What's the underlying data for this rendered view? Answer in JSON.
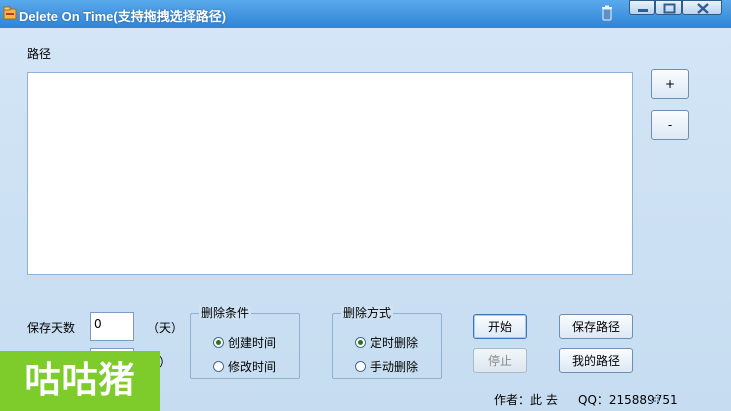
{
  "window": {
    "title": "Delete On Time(支持拖拽选择路径)"
  },
  "path_section": {
    "label": "路径",
    "add_label": "+",
    "remove_label": "-"
  },
  "settings": {
    "days_label": "保存天数",
    "days_value": "0",
    "days_unit": "（天）",
    "second_unit_partial": "点）"
  },
  "delete_condition": {
    "title": "删除条件",
    "options": [
      "创建时间",
      "修改时间"
    ],
    "selected": "创建时间"
  },
  "delete_mode": {
    "title": "删除方式",
    "options": [
      "定时删除",
      "手动删除"
    ],
    "selected": "定时删除"
  },
  "buttons": {
    "start": "开始",
    "stop": "停止",
    "save_path": "保存路径",
    "my_path": "我的路径"
  },
  "status": {
    "author": "作者：此  去",
    "qq": "QQ：215889751"
  },
  "watermark": "咕咕猪",
  "colors": {
    "titlebar": "#3a8fdd",
    "background": "#cfe2f3",
    "watermark": "#7ecb2c",
    "radio_selected": "#1f7a1f"
  }
}
